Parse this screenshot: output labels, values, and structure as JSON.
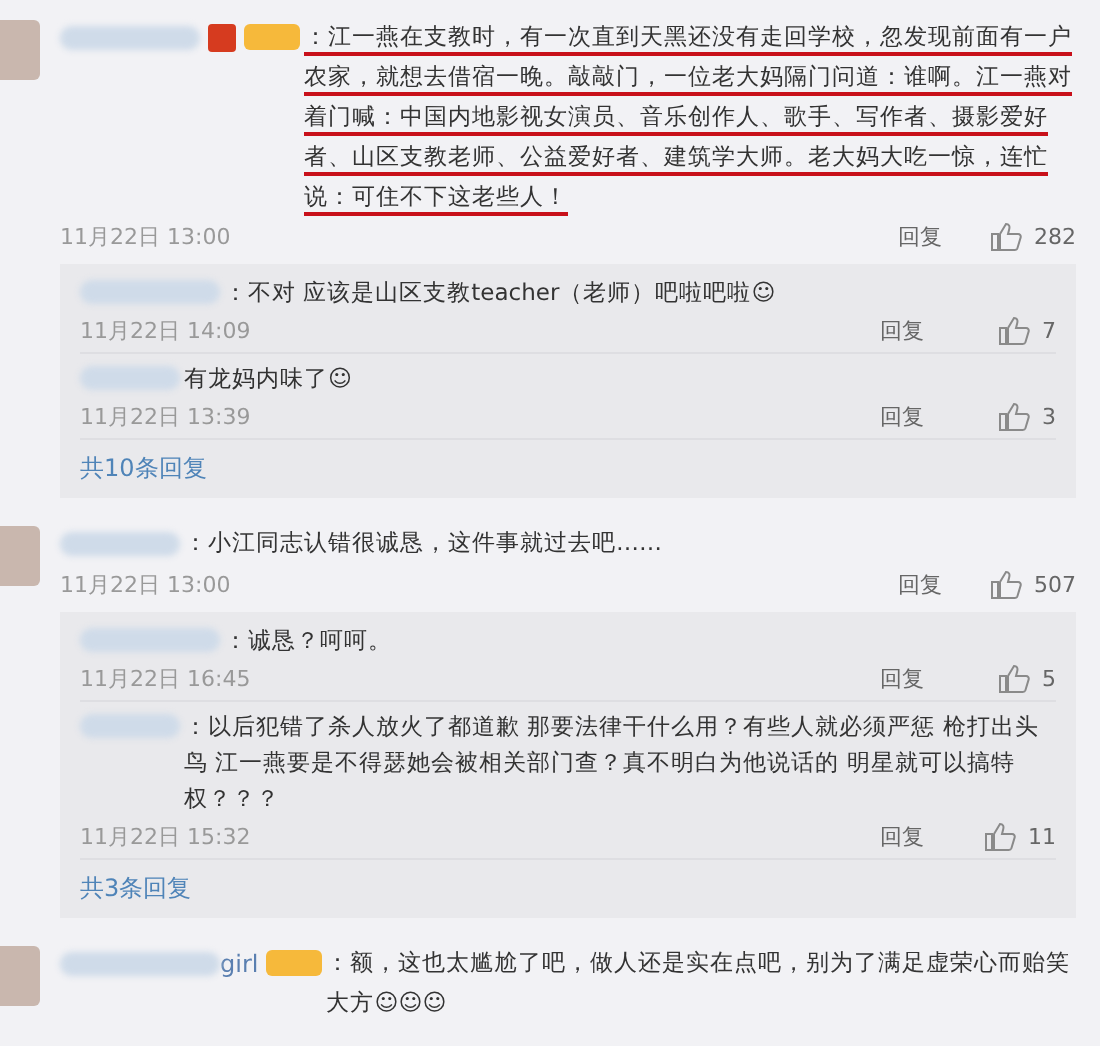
{
  "comments": [
    {
      "verified": true,
      "fan_badge": true,
      "text": "：江一燕在支教时，有一次直到天黑还没有走回学校，忽发现前面有一户农家，就想去借宿一晚。敲敲门，一位老大妈隔门问道：谁啊。江一燕对着门喊：中国内地影视女演员、音乐创作人、歌手、写作者、摄影爱好者、山区支教老师、公益爱好者、建筑学大师。老大妈大吃一惊，连忙说：可住不下这老些人！",
      "underlined": true,
      "time": "11月22日 13:00",
      "reply_label": "回复",
      "likes": "282",
      "replies": [
        {
          "text": "：不对 应该是山区支教teacher（老师）吧啦吧啦☺",
          "time": "11月22日 14:09",
          "reply_label": "回复",
          "likes": "7"
        },
        {
          "text": "有龙妈内味了☺",
          "time": "11月22日 13:39",
          "reply_label": "回复",
          "likes": "3"
        }
      ],
      "more": "共10条回复"
    },
    {
      "verified": false,
      "fan_badge": false,
      "text": "：小江同志认错很诚恳，这件事就过去吧……",
      "underlined": false,
      "time": "11月22日 13:00",
      "reply_label": "回复",
      "likes": "507",
      "replies": [
        {
          "text": "：诚恳？呵呵。",
          "time": "11月22日 16:45",
          "reply_label": "回复",
          "likes": "5"
        },
        {
          "text": "：以后犯错了杀人放火了都道歉 那要法律干什么用？有些人就必须严惩 枪打出头鸟 江一燕要是不得瑟她会被相关部门查？真不明白为他说话的 明星就可以搞特权？？？",
          "time": "11月22日 15:32",
          "reply_label": "回复",
          "likes": "11"
        }
      ],
      "more": "共3条回复"
    },
    {
      "name_suffix": "girl",
      "verified": false,
      "fan_badge": true,
      "text": "：额，这也太尴尬了吧，做人还是实在点吧，别为了满足虚荣心而贻笑大方☺☺☺",
      "underlined": false
    }
  ]
}
